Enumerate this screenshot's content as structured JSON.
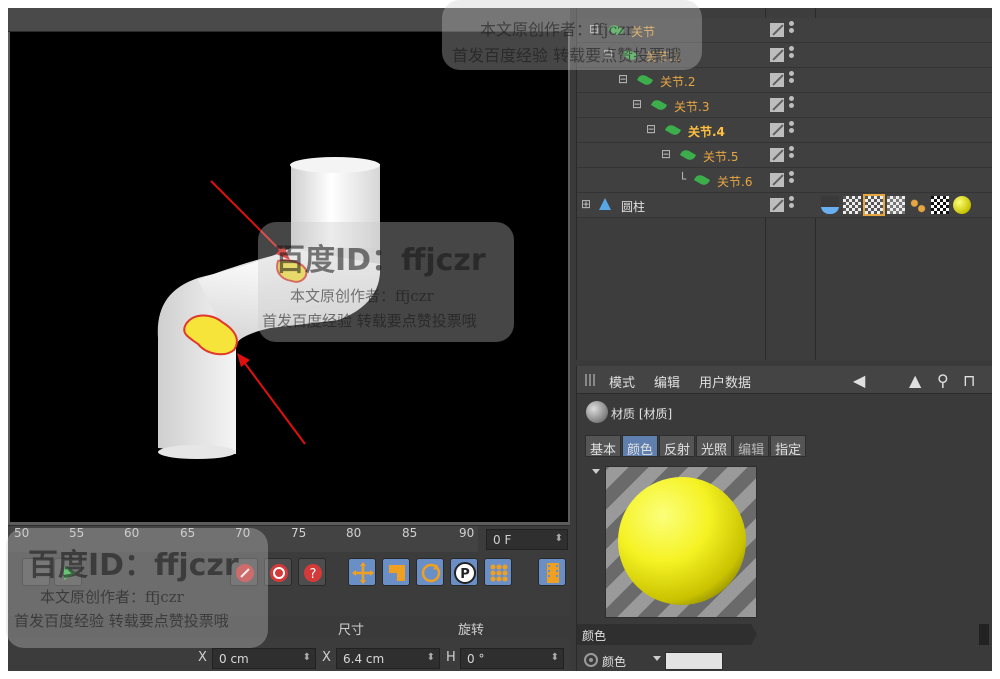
{
  "object_manager": {
    "rows": [
      {
        "name": "关节",
        "indent": 0
      },
      {
        "name": "关节.1",
        "indent": 1
      },
      {
        "name": "关节.2",
        "indent": 2
      },
      {
        "name": "关节.3",
        "indent": 3
      },
      {
        "name": "关节.4",
        "indent": 4
      },
      {
        "name": "关节.5",
        "indent": 5
      },
      {
        "name": "关节.6",
        "indent": 6
      },
      {
        "name": "圆柱",
        "indent": 0
      }
    ]
  },
  "attribute_manager": {
    "menu": {
      "mode": "模式",
      "edit": "编辑",
      "user_data": "用户数据"
    },
    "material_title": "材质 [材质]",
    "tabs": [
      {
        "label": "基本",
        "state": "normal"
      },
      {
        "label": "颜色",
        "state": "active"
      },
      {
        "label": "反射",
        "state": "normal"
      },
      {
        "label": "光照",
        "state": "normal"
      },
      {
        "label": "编辑",
        "state": "dim"
      },
      {
        "label": "指定",
        "state": "normal"
      }
    ],
    "section_title": "颜色",
    "color_param_label": "颜色",
    "color_value": "#e3e3e3",
    "sphere_color": "#f5f224"
  },
  "timeline": {
    "ticks": [
      "50",
      "55",
      "60",
      "65",
      "70",
      "75",
      "80",
      "85",
      "90"
    ],
    "current_frame": "0 F"
  },
  "coordinates": {
    "headers": {
      "size": "尺寸",
      "rotation": "旋转"
    },
    "x_label": "X",
    "x_value": "0 cm",
    "size_label": "X",
    "size_value": "6.4 cm",
    "rot_label": "H",
    "rot_value": "0 °"
  },
  "watermarks": {
    "top_line1": "本文原创作者：ffjczr",
    "top_line2": "首发百度经验 转载要点赞投票哦",
    "mid_id": "百度ID：ffjczr",
    "mid_line1": "本文原创作者：ffjczr",
    "mid_line2": "首发百度经验 转载要点赞投票哦",
    "bot_id": "百度ID：ffjczr",
    "bot_line1": "本文原创作者：ffjczr",
    "bot_line2": "首发百度经验 转载要点赞投票哦"
  }
}
